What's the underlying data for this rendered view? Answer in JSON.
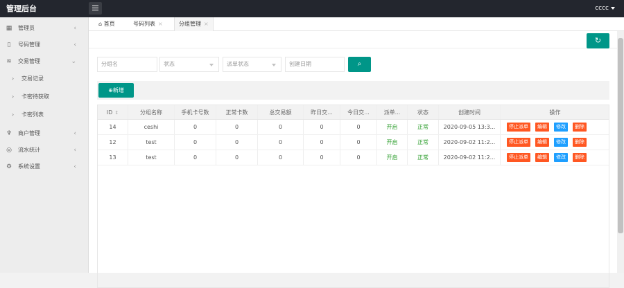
{
  "header": {
    "title": "管理后台",
    "user": "cccc"
  },
  "sidebar": {
    "items": [
      {
        "label": "管理员",
        "icon": "admin-icon"
      },
      {
        "label": "号码管理",
        "icon": "phone-icon"
      },
      {
        "label": "交易管理",
        "icon": "stack-icon"
      },
      {
        "label": "交易记录"
      },
      {
        "label": "卡密待获取"
      },
      {
        "label": "卡密列表"
      },
      {
        "label": "商户管理",
        "icon": "merchant-icon"
      },
      {
        "label": "流水统计",
        "icon": "stats-icon"
      },
      {
        "label": "系统设置",
        "icon": "settings-icon"
      }
    ]
  },
  "tabs": [
    {
      "label": "首页"
    },
    {
      "label": "号码列表"
    },
    {
      "label": "分组管理"
    }
  ],
  "filters": {
    "group_name_placeholder": "分组名",
    "status_placeholder": "状态",
    "dispatch_status_placeholder": "派单状态",
    "create_date_placeholder": "创建日期"
  },
  "toolbar": {
    "add_label": "新增"
  },
  "table": {
    "headers": [
      "ID",
      "分组名称",
      "手机卡号数",
      "正常卡数",
      "总交易额",
      "昨日交...",
      "今日交...",
      "派单...",
      "状态",
      "创建时间",
      "操作"
    ],
    "rows": [
      [
        "14",
        "ceshi",
        "0",
        "0",
        "0",
        "0",
        "0",
        "开启",
        "正常",
        "2020-09-05 13:3..."
      ],
      [
        "12",
        "test",
        "0",
        "0",
        "0",
        "0",
        "0",
        "开启",
        "正常",
        "2020-09-02 11:2..."
      ],
      [
        "13",
        "test",
        "0",
        "0",
        "0",
        "0",
        "0",
        "开启",
        "正常",
        "2020-09-02 11:2..."
      ]
    ],
    "actions": [
      "停止派单",
      "编辑",
      "修改",
      "删除"
    ]
  },
  "colors": {
    "primary": "#009688",
    "orange": "#ff5722",
    "blue": "#1e9fff",
    "header_bg": "#23262e"
  }
}
